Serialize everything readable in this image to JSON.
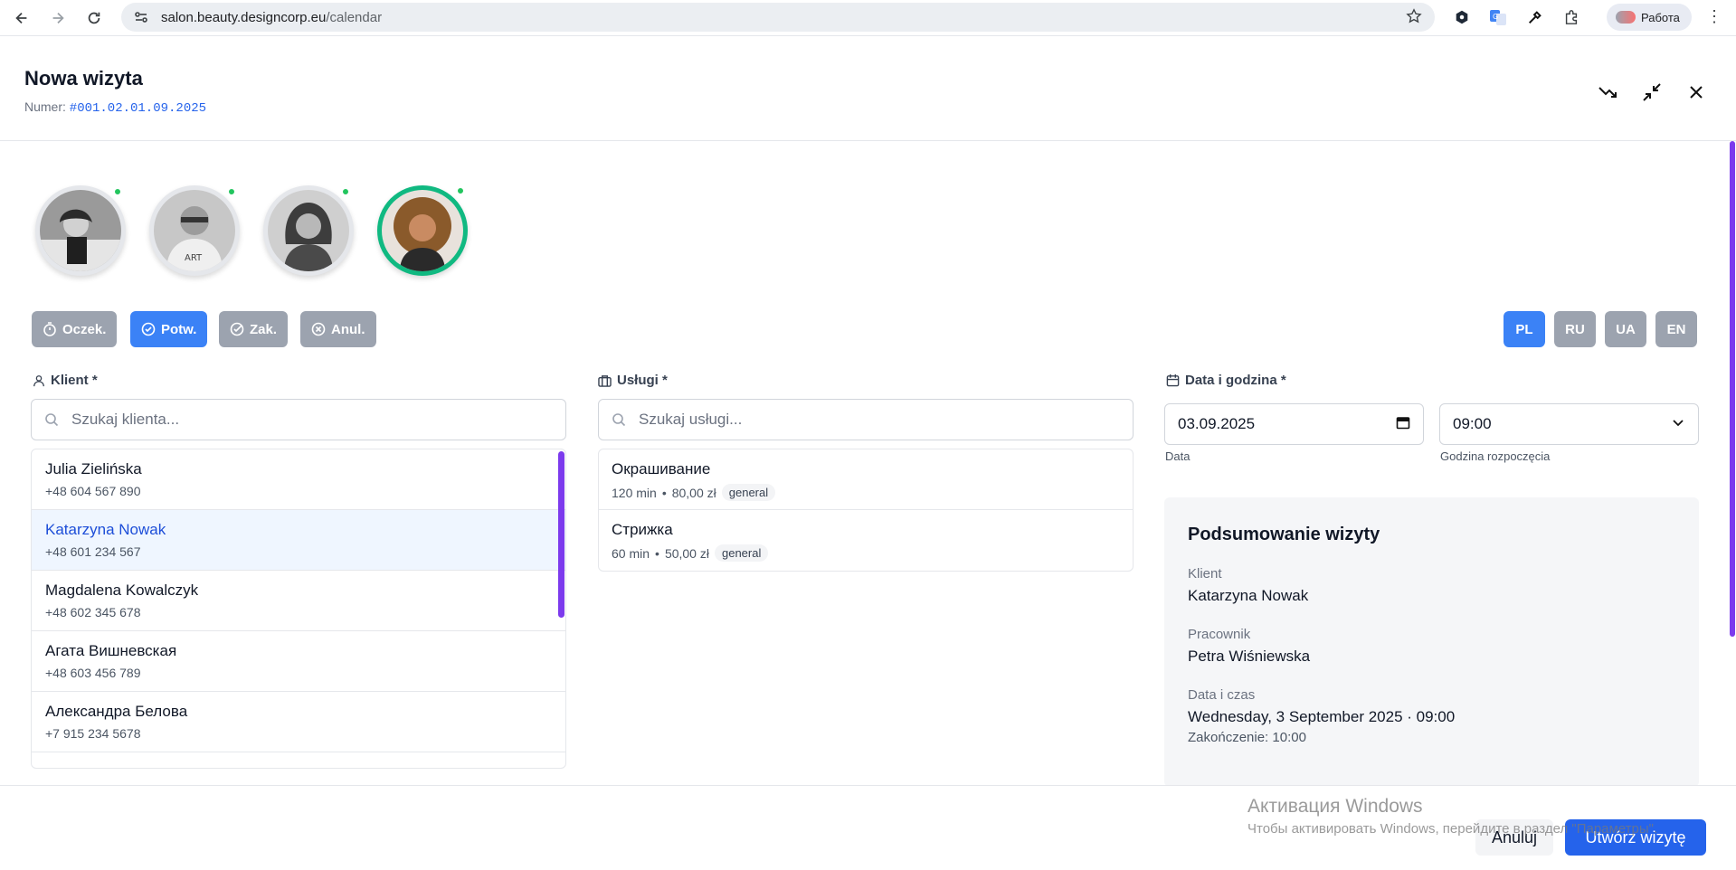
{
  "browser": {
    "url_host": "salon.beauty.designcorp.eu",
    "url_path": "/calendar",
    "profile_label": "Работа"
  },
  "header": {
    "title": "Nowa wizyta",
    "number_label": "Numer:",
    "number_code": "#001.02.01.09.2025"
  },
  "staff": [
    {
      "name": "staff-1",
      "online": true,
      "selected": false
    },
    {
      "name": "staff-2",
      "online": true,
      "selected": false
    },
    {
      "name": "staff-3",
      "online": true,
      "selected": false
    },
    {
      "name": "staff-4",
      "online": true,
      "selected": true
    }
  ],
  "status": {
    "pending": "Oczek.",
    "confirmed": "Potw.",
    "completed": "Zak.",
    "cancelled": "Anul.",
    "active": "confirmed",
    "active_color": "#3b82f6",
    "inactive_color": "#9ca3af"
  },
  "languages": {
    "pl": "PL",
    "ru": "RU",
    "ua": "UA",
    "en": "EN",
    "active": "PL"
  },
  "client": {
    "label": "Klient *",
    "search_placeholder": "Szukaj klienta...",
    "items": [
      {
        "name": "Julia Zielińska",
        "phone": "+48 604 567 890"
      },
      {
        "name": "Katarzyna Nowak",
        "phone": "+48 601 234 567"
      },
      {
        "name": "Magdalena Kowalczyk",
        "phone": "+48 602 345 678"
      },
      {
        "name": "Агата Вишневская",
        "phone": "+48 603 456 789"
      },
      {
        "name": "Александра Белова",
        "phone": "+7 915 234 5678"
      }
    ],
    "selected": "Katarzyna Nowak"
  },
  "services": {
    "label": "Usługi *",
    "search_placeholder": "Szukaj usługi...",
    "items": [
      {
        "name": "Окрашивание",
        "duration": "120 min",
        "price": "80,00 zł",
        "tag": "general"
      },
      {
        "name": "Стрижка",
        "duration": "60 min",
        "price": "50,00 zł",
        "tag": "general"
      }
    ]
  },
  "datetime": {
    "label": "Data i godzina *",
    "date_value": "03.09.2025",
    "date_sub": "Data",
    "time_value": "09:00",
    "time_sub": "Godzina rozpoczęcia"
  },
  "summary": {
    "title": "Podsumowanie wizyty",
    "client_label": "Klient",
    "client_value": "Katarzyna Nowak",
    "employee_label": "Pracownik",
    "employee_value": "Petra Wiśniewska",
    "datetime_label": "Data i czas",
    "datetime_value": "Wednesday, 3 September 2025 · 09:00",
    "end_label": "Zakończenie: 10:00"
  },
  "footer": {
    "cancel": "Anuluj",
    "create": "Utwórz wizytę",
    "watermark_title": "Активация Windows",
    "watermark_sub": "Чтобы активировать Windows, перейдите в раздел \"Параметры\"."
  }
}
